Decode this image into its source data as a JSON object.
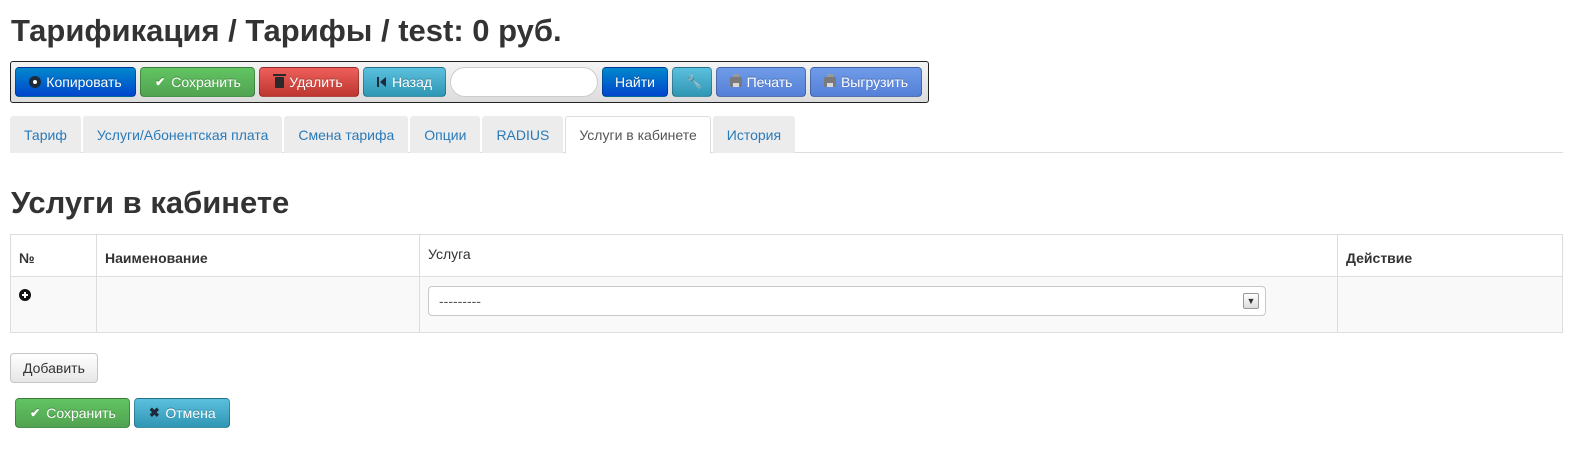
{
  "page": {
    "title": "Тарификация / Тарифы / test: 0 руб."
  },
  "toolbar": {
    "copy_label": "Копировать",
    "save_label": "Сохранить",
    "delete_label": "Удалить",
    "back_label": "Назад",
    "search_value": "",
    "search_placeholder": "",
    "find_label": "Найти",
    "print_label": "Печать",
    "export_label": "Выгрузить"
  },
  "tabs": [
    {
      "label": "Тариф",
      "active": false
    },
    {
      "label": "Услуги/Абонентская плата",
      "active": false
    },
    {
      "label": "Смена тарифа",
      "active": false
    },
    {
      "label": "Опции",
      "active": false
    },
    {
      "label": "RADIUS",
      "active": false
    },
    {
      "label": "Услуги в кабинете",
      "active": true
    },
    {
      "label": "История",
      "active": false
    }
  ],
  "section": {
    "title": "Услуги в кабинете",
    "table": {
      "headers": [
        "№",
        "Наименование",
        "Услуга",
        "Действие"
      ],
      "rows": [
        {
          "number": "",
          "name": "",
          "service_selected": "---------",
          "action": ""
        }
      ]
    }
  },
  "actions": {
    "add_label": "Добавить",
    "save_label": "Сохранить",
    "cancel_label": "Отмена"
  },
  "icons": {
    "copy": "copy-circle-icon",
    "save": "check-icon",
    "delete": "trash-icon",
    "back": "step-backward-icon",
    "settings": "wrench-icon",
    "print": "printer-icon",
    "export": "printer-icon",
    "add_row": "plus-circle-icon",
    "cancel": "x-icon"
  },
  "colors": {
    "primary": "#0055cc",
    "success": "#51a351",
    "danger": "#bd362f",
    "info": "#2f96b4",
    "soft_blue": "#5c87dc",
    "tab_link": "#2a7ab8"
  }
}
